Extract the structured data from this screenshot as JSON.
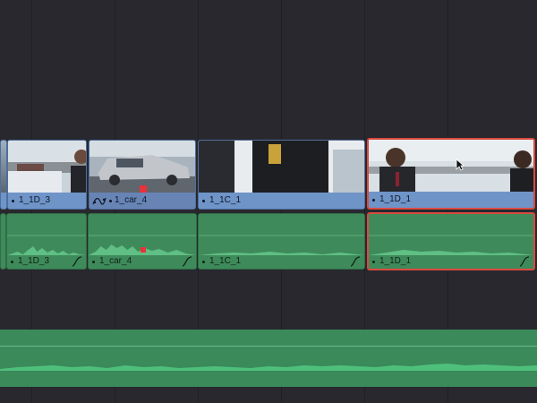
{
  "timeline": {
    "video_clips": [
      {
        "name": "",
        "label": ""
      },
      {
        "name": "1_1D_3",
        "label": "1_1D_3"
      },
      {
        "name": "1_car_4",
        "label": "1_car_4"
      },
      {
        "name": "1_1C_1",
        "label": "1_1C_1"
      },
      {
        "name": "1_1D_1",
        "label": "1_1D_1",
        "selected": true
      }
    ],
    "audio_clips": [
      {
        "name": "1_1D_3",
        "label": "1_1D_3"
      },
      {
        "name": "1_car_4",
        "label": "1_car_4"
      },
      {
        "name": "1_1C_1",
        "label": "1_1C_1"
      },
      {
        "name": "1_1D_1",
        "label": "1_1D_1",
        "selected": true
      }
    ],
    "colors": {
      "background": "#28282e",
      "video_clip": "#6a8fc4",
      "audio_clip": "#3f8a5a",
      "selection": "#d94a3f",
      "marker": "#e8323a"
    },
    "icons": [
      "speed-ramp-icon",
      "fade-curve-icon",
      "marker-icon",
      "pointer-cursor-icon"
    ]
  }
}
